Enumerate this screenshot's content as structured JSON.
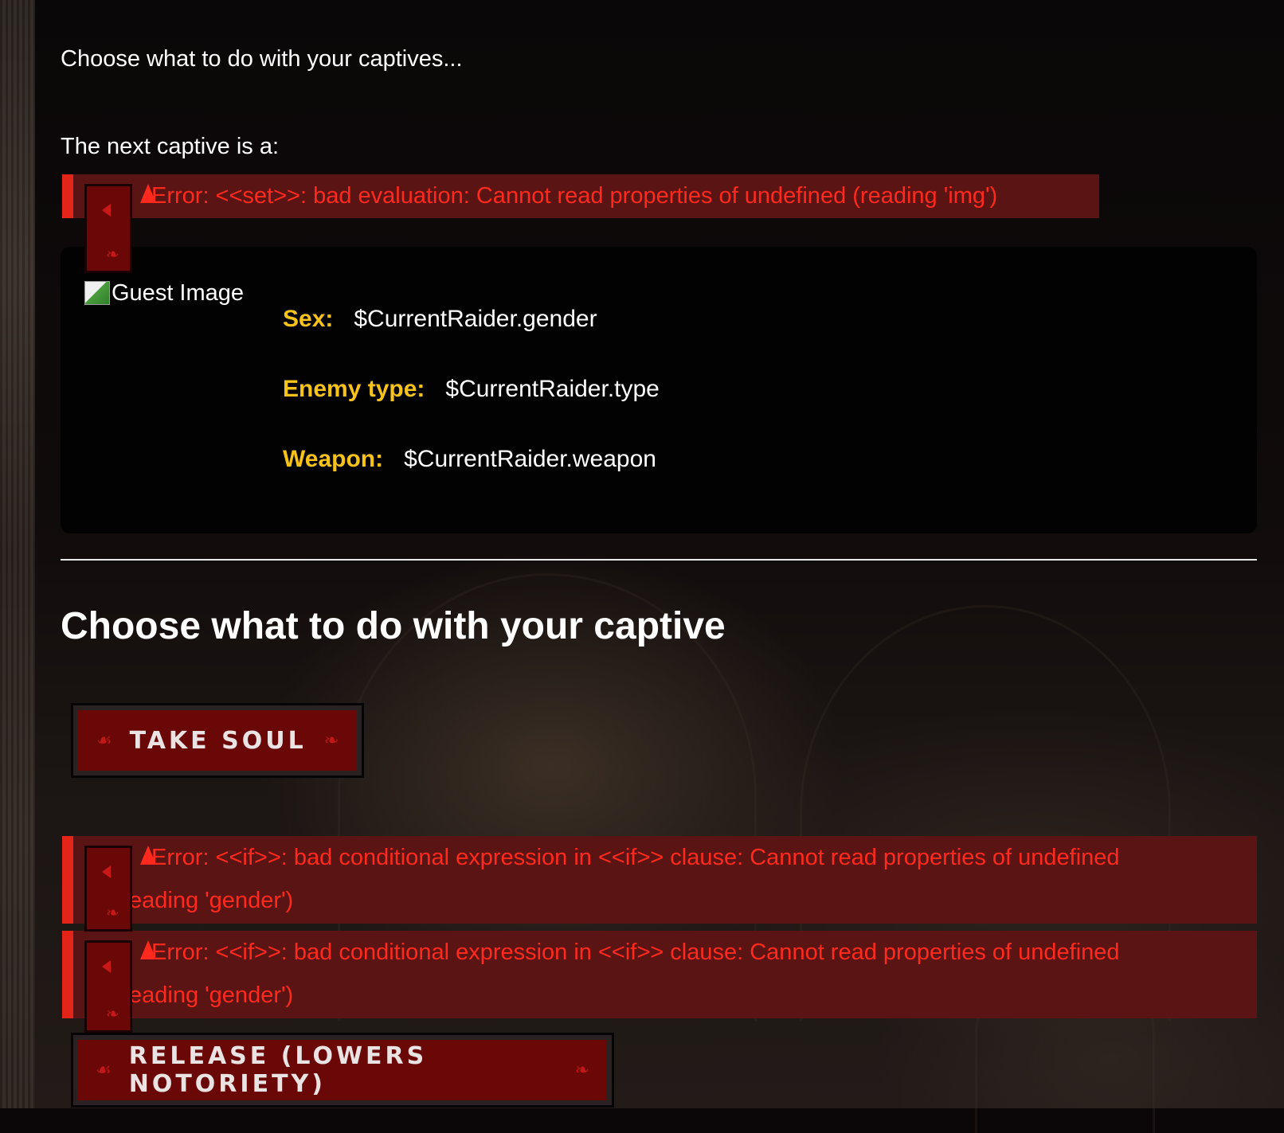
{
  "intro_text": "Choose what to do with your captives...",
  "next_text": "The next captive is a:",
  "errors": [
    {
      "line1": "Error: <<set>>: bad evaluation: Cannot read properties of undefined (reading 'img')",
      "line2": ""
    },
    {
      "line1": "Error: <<if>>: bad conditional expression in <<if>> clause: Cannot read properties of undefined",
      "line2": "eading 'gender')"
    },
    {
      "line1": "Error: <<if>>: bad conditional expression in <<if>> clause: Cannot read properties of undefined",
      "line2": "eading 'gender')"
    }
  ],
  "image_alt": "Guest Image",
  "stats": {
    "sex_label": "Sex:",
    "sex_value": "$CurrentRaider.gender",
    "type_label": "Enemy type:",
    "type_value": "$CurrentRaider.type",
    "weapon_label": "Weapon:",
    "weapon_value": "$CurrentRaider.weapon"
  },
  "heading": "Choose what to do with your captive",
  "buttons": {
    "take_soul": "TAKE SOUL",
    "release": "RELEASE (LOWERS NOTORIETY)",
    "fleuron_left": "☙",
    "fleuron_right": "❧"
  },
  "icons": {
    "error": "warning-icon",
    "toggle": "triangle-left-icon",
    "fleuron": "fleuron-icon"
  },
  "colors": {
    "error_text": "#ff2a1d",
    "error_bg": "#5a1414",
    "stat_label": "#f7c31a",
    "button_bg": "#6a0707"
  }
}
